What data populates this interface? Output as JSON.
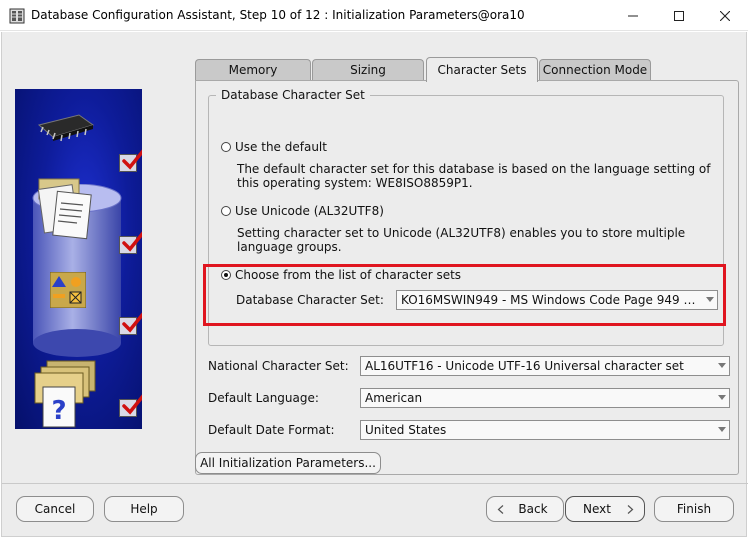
{
  "window": {
    "title": "Database Configuration Assistant, Step 10 of 12 : Initialization Parameters@ora10",
    "icons": {
      "app": "database-app-icon",
      "minimize": "minimize-icon",
      "maximize": "maximize-icon",
      "close": "close-icon"
    }
  },
  "tabs": [
    {
      "label": "Memory",
      "active": false
    },
    {
      "label": "Sizing",
      "active": false
    },
    {
      "label": "Character Sets",
      "active": true
    },
    {
      "label": "Connection Mode",
      "active": false
    }
  ],
  "db_charset_group": {
    "legend": "Database Character Set",
    "options": [
      {
        "label": "Use the default",
        "selected": false,
        "description": "The default character set for this database is based on the language setting of this operating system: WE8ISO8859P1."
      },
      {
        "label": "Use Unicode (AL32UTF8)",
        "selected": false,
        "description": "Setting character set to Unicode (AL32UTF8) enables you to store multiple language groups."
      },
      {
        "label": "Choose from the list of character sets",
        "selected": true
      }
    ],
    "charset_label": "Database Character Set:",
    "charset_value": "KO16MSWIN949 - MS Windows Code Page 949 K..."
  },
  "fields": {
    "national_charset": {
      "label": "National Character Set:",
      "value": "AL16UTF16 - Unicode UTF-16 Universal character set"
    },
    "default_language": {
      "label": "Default Language:",
      "value": "American"
    },
    "default_date_format": {
      "label": "Default Date Format:",
      "value": "United States"
    }
  },
  "all_params_button": "All Initialization Parameters...",
  "footer": {
    "cancel": "Cancel",
    "help": "Help",
    "back": "Back",
    "next": "Next",
    "finish": "Finish"
  },
  "side_steps": [
    {
      "icon": "memory-chip-icon",
      "checked": true
    },
    {
      "icon": "documents-icon",
      "checked": true
    },
    {
      "icon": "shapes-icon",
      "checked": true
    },
    {
      "icon": "folders-question-icon",
      "checked": true
    }
  ],
  "colors": {
    "highlight": "#e0151f",
    "side_panel": "#0e1c9a",
    "checkmark": "#d01010"
  }
}
